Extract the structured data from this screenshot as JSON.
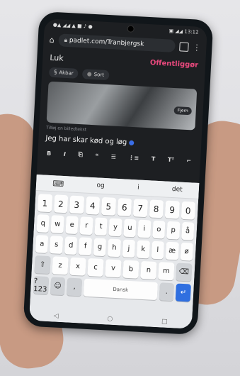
{
  "status": {
    "left": "●▲ ◢◢ ▲ ■ ♪ ●",
    "right": "▣ ◢◢ 13:12"
  },
  "browser": {
    "url": "padlet.com/Tranbjergsk",
    "tab_count": "⬛"
  },
  "app": {
    "close_label": "Luk",
    "publish_label": "Offentliggør"
  },
  "chips": [
    {
      "label": "Akbar"
    },
    {
      "label": "Sort"
    }
  ],
  "attachment": {
    "remove_label": "Fjern"
  },
  "caption_placeholder": "Tilføj en billedtekst",
  "body_text": "Jeg har skar kød og løg",
  "format_bar": [
    "B",
    "I",
    "⎘",
    "❝",
    "☰",
    "⋮≡",
    "T",
    "Tᵀ",
    "⌐"
  ],
  "keyboard": {
    "suggestions": [
      "og",
      "i",
      "det"
    ],
    "row_numbers": [
      "1",
      "2",
      "3",
      "4",
      "5",
      "6",
      "7",
      "8",
      "9",
      "0"
    ],
    "row1": [
      "q",
      "w",
      "e",
      "r",
      "t",
      "y",
      "u",
      "i",
      "o",
      "p",
      "å"
    ],
    "row2": [
      "a",
      "s",
      "d",
      "f",
      "g",
      "h",
      "j",
      "k",
      "l",
      "æ",
      "ø"
    ],
    "row3": [
      "z",
      "x",
      "c",
      "v",
      "b",
      "n",
      "m"
    ],
    "space_label": "Dansk"
  }
}
